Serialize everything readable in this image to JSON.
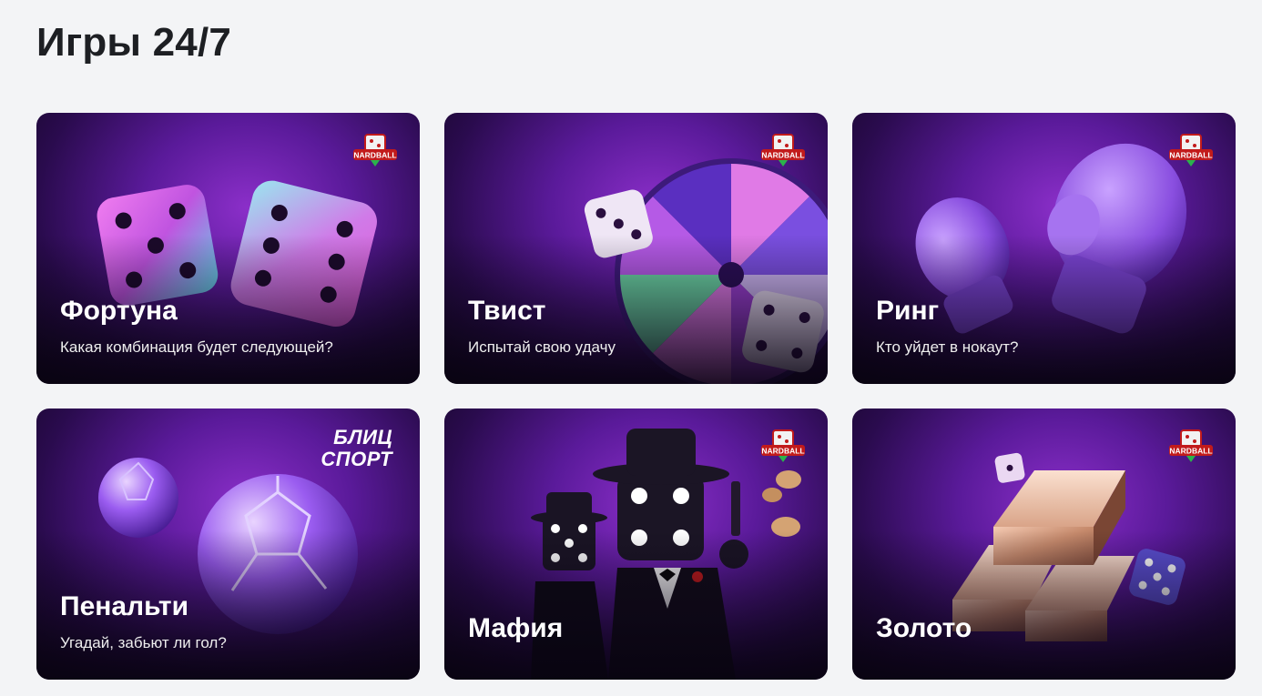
{
  "page": {
    "title": "Игры 24/7"
  },
  "brand": {
    "badge_text": "NARDBALL",
    "blitz_line1": "БЛИЦ",
    "blitz_line2": "СПОРТ"
  },
  "colors": {
    "background": "#f3f4f6",
    "title": "#1d1f23",
    "card_accent": "#8b2fc9",
    "card_text": "#ffffff"
  },
  "games": [
    {
      "title": "Фортуна",
      "subtitle": "Какая комбинация будет следующей?",
      "icon": "dice-icon",
      "badge": "nardball"
    },
    {
      "title": "Твист",
      "subtitle": "Испытай свою удачу",
      "icon": "wheel-icon",
      "badge": "nardball"
    },
    {
      "title": "Ринг",
      "subtitle": "Кто уйдет в нокаут?",
      "icon": "boxing-glove-icon",
      "badge": "nardball"
    },
    {
      "title": "Пенальти",
      "subtitle": "Угадай, забьют ли гол?",
      "icon": "soccer-ball-icon",
      "badge": "blitz-sport"
    },
    {
      "title": "Мафия",
      "subtitle": "",
      "icon": "mafia-dice-icon",
      "badge": "nardball"
    },
    {
      "title": "Золото",
      "subtitle": "",
      "icon": "gold-bar-icon",
      "badge": "nardball"
    }
  ]
}
